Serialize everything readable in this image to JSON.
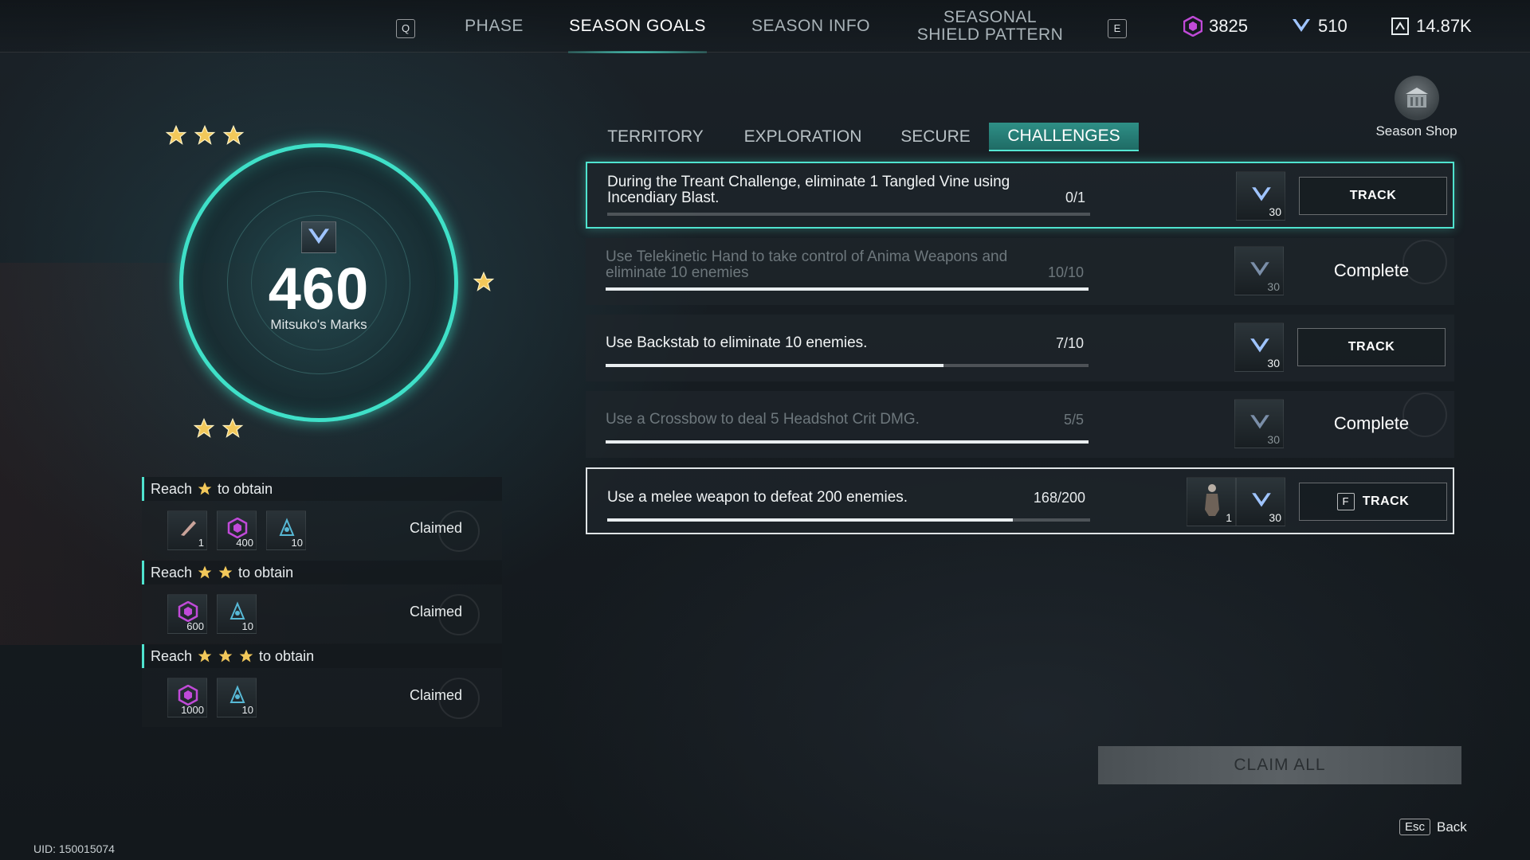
{
  "nav": {
    "key_left": "Q",
    "key_right": "E",
    "tabs": [
      {
        "label": "PHASE"
      },
      {
        "label": "SEASON GOALS"
      },
      {
        "label": "SEASON INFO"
      },
      {
        "label": "SEASONAL SHIELD PATTERN"
      }
    ],
    "active_tab": "SEASON GOALS"
  },
  "currencies": [
    {
      "icon": "gem-icon",
      "value": "3825",
      "color": "#c04ad8"
    },
    {
      "icon": "mark-icon",
      "value": "510",
      "color": "#a8c8ff"
    },
    {
      "icon": "cube-icon",
      "value": "14.87K",
      "color": "#e8eef0"
    }
  ],
  "season_shop": {
    "label": "Season Shop",
    "icon": "shop-icon"
  },
  "dial": {
    "value": "460",
    "label": "Mitsuko's Marks",
    "accent": "#3fe0c8"
  },
  "tiers": [
    {
      "head_prefix": "Reach",
      "stars": 1,
      "head_suffix": "to obtain",
      "items": [
        {
          "icon": "feather-icon",
          "qty": "1"
        },
        {
          "icon": "gem-icon",
          "qty": "400"
        },
        {
          "icon": "crystal-icon",
          "qty": "10"
        }
      ],
      "status": "Claimed"
    },
    {
      "head_prefix": "Reach",
      "stars": 2,
      "head_suffix": "to obtain",
      "items": [
        {
          "icon": "gem-icon",
          "qty": "600"
        },
        {
          "icon": "crystal-icon",
          "qty": "10"
        }
      ],
      "status": "Claimed"
    },
    {
      "head_prefix": "Reach",
      "stars": 3,
      "head_suffix": "to obtain",
      "items": [
        {
          "icon": "gem-icon",
          "qty": "1000"
        },
        {
          "icon": "crystal-icon",
          "qty": "10"
        }
      ],
      "status": "Claimed"
    }
  ],
  "subtabs": [
    {
      "label": "TERRITORY"
    },
    {
      "label": "EXPLORATION"
    },
    {
      "label": "SECURE"
    },
    {
      "label": "CHALLENGES"
    }
  ],
  "active_subtab": "CHALLENGES",
  "challenges": [
    {
      "text": "During the Treant Challenge, eliminate 1 Tangled Vine using Incendiary Blast.",
      "count": "0/1",
      "progress": 0,
      "reward_qty": "30",
      "action": "TRACK",
      "state": "highlight"
    },
    {
      "text": "Use Telekinetic Hand to take control of Anima Weapons and eliminate 10 enemies",
      "count": "10/10",
      "progress": 1,
      "reward_qty": "30",
      "action": "Complete",
      "state": "done"
    },
    {
      "text": "Use Backstab to eliminate 10 enemies.",
      "count": "7/10",
      "progress": 0.7,
      "reward_qty": "30",
      "action": "TRACK",
      "state": "normal"
    },
    {
      "text": "Use a Crossbow to deal 5 Headshot Crit DMG.",
      "count": "5/5",
      "progress": 1,
      "reward_qty": "30",
      "action": "Complete",
      "state": "done"
    },
    {
      "text": "Use a melee weapon to defeat 200 enemies.",
      "count": "168/200",
      "progress": 0.84,
      "reward_qty": "30",
      "extra_reward_qty": "1",
      "action": "TRACK",
      "action_key": "F",
      "state": "selected"
    }
  ],
  "claim_all": "CLAIM ALL",
  "back": {
    "key": "Esc",
    "label": "Back"
  },
  "uid": "UID: 150015074"
}
